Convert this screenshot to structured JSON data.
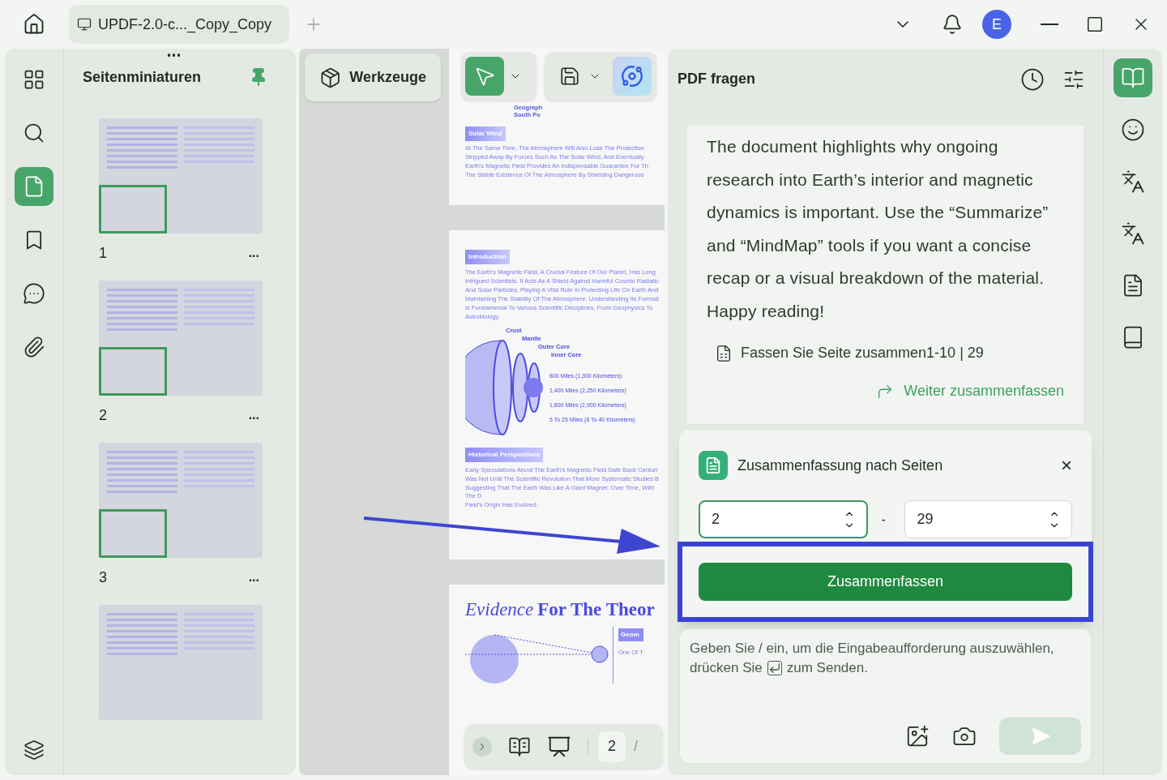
{
  "tab": {
    "title": "UPDF-2.0-c..._Copy_Copy"
  },
  "user": {
    "initial": "E"
  },
  "left_rail": [
    {
      "selected": false
    },
    {
      "selected": false
    },
    {
      "selected": true
    },
    {
      "selected": false
    },
    {
      "selected": false
    },
    {
      "selected": false
    }
  ],
  "thumbnails": {
    "title": "Seitenminiaturen",
    "pinned": true,
    "pages": [
      {
        "number": "1",
        "in_view": true,
        "more": "..."
      },
      {
        "number": "2",
        "in_view": true,
        "more": "..."
      },
      {
        "number": "3",
        "in_view": true,
        "more": "..."
      },
      {
        "in_view": false
      }
    ]
  },
  "toolbar": {
    "tools_label": "Werkzeuge",
    "cursor_selected": true
  },
  "document": {
    "page1": {
      "caption": [
        "Geograph",
        "South Po"
      ],
      "badge": "Solar Wind",
      "lines": [
        "At The Same Time, The Atmosphere Will Also Lose The Protection",
        "Stripped Away By Forces Such As The Solar Wind, And Eventually",
        "Earth's Magnetic Field Provides An Indispensable Guarantee For Th",
        "The Stable Existence Of The Atmosphere By Shielding Dangerous"
      ]
    },
    "page2": {
      "badge": "Introduction",
      "lines": [
        "The Earth's Magnetic Field, A Crucial Feature Of Our Planet, Has Long",
        "Intrigued Scientists. It Acts As A Shield Against Harmful Cosmic Radiatic",
        "And Solar Particles, Playing A Vital Role In Protecting Life On Earth And",
        "Maintaining The Stability Of The Atmosphere. Understanding Its Formati",
        "Is Fundamental To Various Scientific Disciplines, From Geophysics To",
        "Astrobiology."
      ],
      "layers": [
        "Crust",
        "Mantle",
        "Outer Core",
        "Inner Core"
      ],
      "distances": [
        "800 Miles (1,300 Kilometers)",
        "1,400 Miles (2,250 Kilometers)",
        "1,800 Miles (2,900 Kilometers)",
        "5 To 25 Miles (8 To 40 Kilometers)"
      ],
      "badge2": "Historical Perspectives",
      "lines2": [
        "Early Speculations About The Earth's Magnetic Field Date Back Centuri",
        "Was Not Until The Scientific Revolution That More Systematic Studies B",
        "Suggesting That The Earth Was Like A Giant Magnet. Over Time, With The D",
        "Field's Origin Has Evolved."
      ]
    },
    "page3": {
      "title_italic": "Evidence",
      "title_rest": "For The Theor",
      "badge": "Geom",
      "line": "One Of T"
    }
  },
  "page_nav": {
    "current": "2",
    "separator": "/"
  },
  "chat": {
    "title": "PDF fragen",
    "message": "The document highlights why ongoing research into Earth’s interior and magnetic dynamics is important. Use the “Summarize” and “MindMap” tools if you want a concise recap or a visual breakdown of the material. Happy reading!",
    "summary_ref": "Fassen Sie Seite zusammen1-10 | 29",
    "continue_link": "Weiter zusammenfassen"
  },
  "popup": {
    "title": "Zusammenfassung nach Seiten",
    "close": "×",
    "from": "2",
    "dash": "-",
    "to": "29",
    "button": "Zusammenfassen",
    "highlighted": true
  },
  "input": {
    "hint_line": "Geben Sie / ein, um die Eingabeaufforderung auszuwählen,",
    "hint_before": "drücken Sie",
    "hint_after": "zum Senden.",
    "send_disabled": true
  },
  "right_rail": [
    {
      "selected": true
    },
    {
      "selected": false
    },
    {
      "selected": false
    },
    {
      "selected": false
    },
    {
      "selected": false
    },
    {
      "selected": false
    }
  ]
}
